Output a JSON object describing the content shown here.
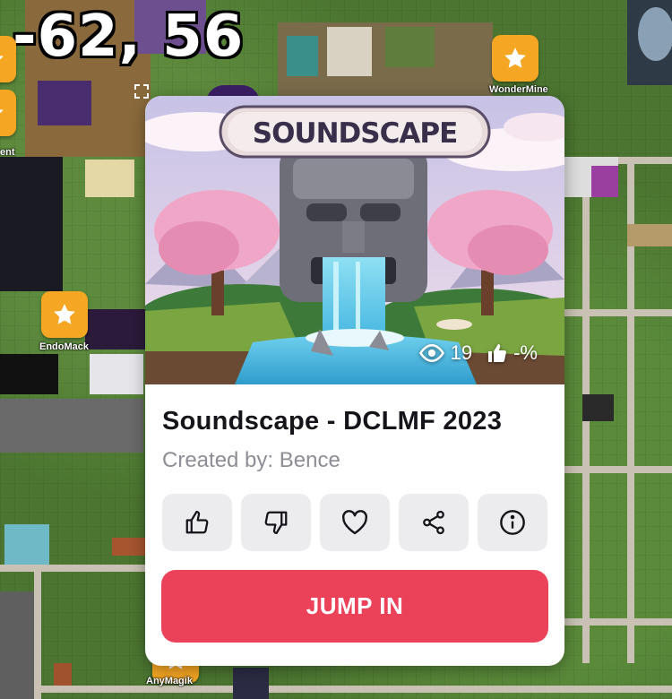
{
  "map": {
    "coordinates": "-62, 56",
    "markers": [
      {
        "label": "WonderMine"
      },
      {
        "label": "EndoMack"
      },
      {
        "label": "AnyMagik"
      },
      {
        "label": "ent"
      }
    ]
  },
  "scene_card": {
    "logo_text": "SOUNDSCAPE",
    "stats": {
      "views": "19",
      "likes": "-%"
    },
    "title": "Soundscape - DCLMF 2023",
    "created_by_label": "Created by:",
    "creator": "Bence",
    "actions": [
      {
        "icon": "thumbs-up-icon"
      },
      {
        "icon": "thumbs-down-icon"
      },
      {
        "icon": "heart-icon"
      },
      {
        "icon": "share-icon"
      },
      {
        "icon": "info-icon"
      }
    ],
    "jump_in_label": "JUMP IN",
    "accent": "#eb4259"
  }
}
